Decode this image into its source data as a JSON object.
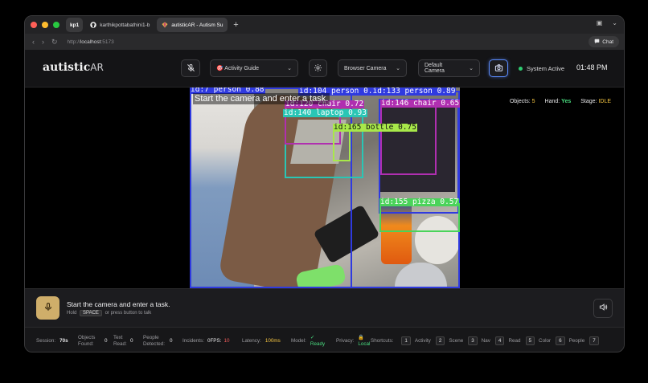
{
  "browser": {
    "tabs": [
      {
        "label": "kp1",
        "type": "group"
      },
      {
        "label": "karthikpottabathini1-b",
        "icon": "github-icon"
      },
      {
        "label": "autisticAR - Autism Su",
        "icon": "app-icon",
        "active": true
      }
    ],
    "url_prefix": "http://",
    "url_host": "localhost",
    "url_port": ":5173",
    "chat_label": "Chat"
  },
  "header": {
    "logo_main": "autistic",
    "logo_suffix": "AR",
    "mode_label": "Activity Guide",
    "camera_source": "Browser Camera",
    "camera_device": "Default Camera",
    "status": "System Active",
    "time": "01:48 PM"
  },
  "video": {
    "task_text": "Start the camera and enter a task.",
    "hud": {
      "objects_label": "Objects:",
      "objects_value": "5",
      "hand_label": "Hand:",
      "hand_value": "Yes",
      "stage_label": "Stage:",
      "stage_value": "IDLE"
    },
    "detections": [
      {
        "label": "id:7 person 0.88",
        "color": "#2f3ae0"
      },
      {
        "label": "id:104 person 0.id:133 person 0.89",
        "color": "#2f3ae0"
      },
      {
        "label": "id:120 chair 0.72",
        "color": "#b02fb0"
      },
      {
        "label": "id:140 laptop 0.93",
        "color": "#29c6b5"
      },
      {
        "label": "id:165 bottle 0.75",
        "color": "#a8e84a"
      },
      {
        "label": "id:146 chair 0.65",
        "color": "#b02fb0"
      },
      {
        "label": "id:155 pizza 0.57",
        "color": "#4ad35a"
      }
    ]
  },
  "voice": {
    "prompt": "Start the camera and enter a task.",
    "hint_pre": "Hold",
    "hint_key": "SPACE",
    "hint_post": "or press button to talk"
  },
  "footer": {
    "session_label": "Session:",
    "session_value": "70s",
    "objects_label": "Objects Found:",
    "objects_value": "0",
    "text_label": "Text Read:",
    "text_value": "0",
    "people_label": "People Detected:",
    "people_value": "0",
    "incidents_label": "Incidents:",
    "incidents_value": "0FPS:",
    "fps_value": "10",
    "latency_label": "Latency:",
    "latency_value": "100ms",
    "model_label": "Model:",
    "model_value": "Ready",
    "privacy_label": "Privacy:",
    "privacy_value": "Local",
    "shortcuts_label": "Shortcuts:",
    "shortcuts": [
      {
        "key": "1",
        "label": "Activity"
      },
      {
        "key": "2",
        "label": "Scene"
      },
      {
        "key": "3",
        "label": "Nav"
      },
      {
        "key": "4",
        "label": "Read"
      },
      {
        "key": "5",
        "label": "Color"
      },
      {
        "key": "6",
        "label": "People"
      },
      {
        "key": "7",
        "label": ""
      }
    ]
  },
  "colors": {
    "accent_blue": "#5b8cff",
    "status_green": "#2ecc71",
    "mic_gold": "#cfae6a",
    "warn_yellow": "#f5c542"
  }
}
